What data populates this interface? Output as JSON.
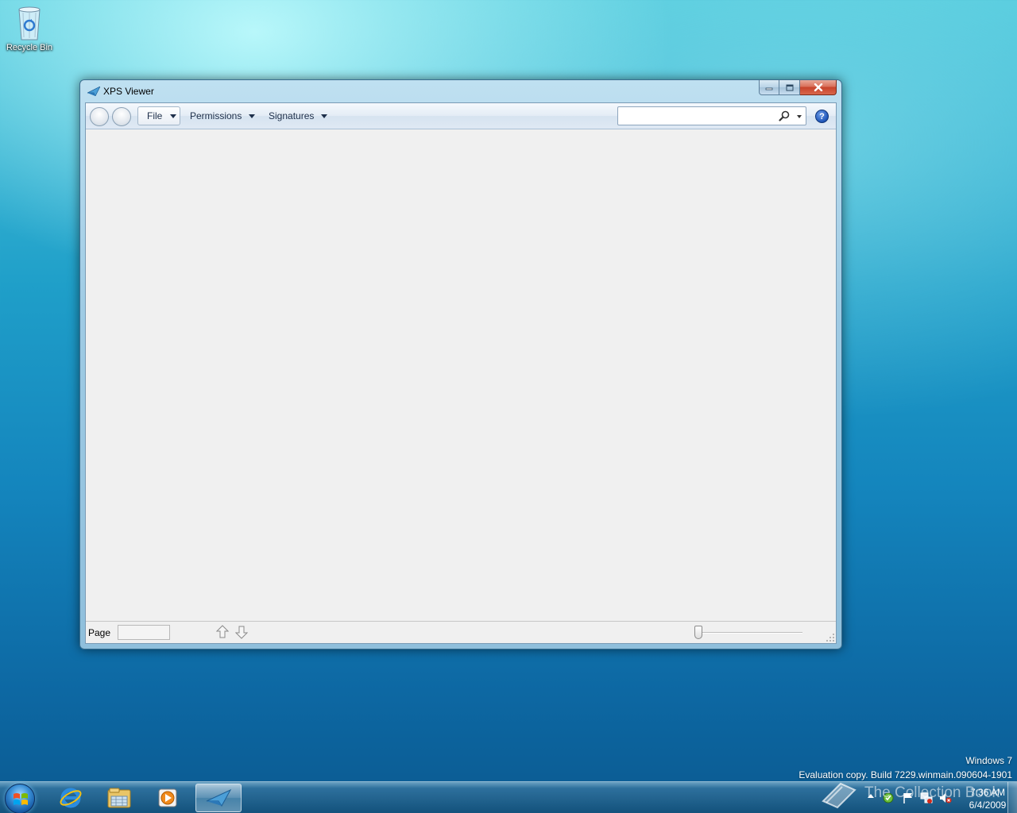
{
  "desktop": {
    "icons": [
      {
        "label": "Recycle Bin",
        "icon": "recycle-bin-icon"
      }
    ],
    "watermark": {
      "line1": "Windows 7",
      "line2": "Evaluation copy. Build 7229.winmain.090604-1901"
    },
    "overlay_logo_text": "The Collection Book"
  },
  "window": {
    "title": "XPS Viewer",
    "app_icon": "xps-viewer-icon",
    "controls": {
      "minimize": "minimize-icon",
      "maximize": "maximize-icon",
      "close": "close-icon"
    },
    "toolbar": {
      "back": "back-arrow-icon",
      "forward": "forward-arrow-icon",
      "menus": [
        {
          "label": "File"
        },
        {
          "label": "Permissions"
        },
        {
          "label": "Signatures"
        }
      ],
      "search": {
        "value": "",
        "placeholder": "",
        "icon": "search-icon"
      },
      "help": "?"
    },
    "statusbar": {
      "page_label": "Page",
      "page_value": "",
      "prev_page": "up-arrow-icon",
      "next_page": "down-arrow-icon",
      "zoom_level": 0
    }
  },
  "taskbar": {
    "start": "windows-start-icon",
    "pinned": [
      {
        "name": "Internet Explorer",
        "icon": "internet-explorer-icon"
      },
      {
        "name": "Windows Explorer",
        "icon": "folder-icon"
      },
      {
        "name": "Windows Media Player",
        "icon": "media-player-icon"
      },
      {
        "name": "XPS Viewer",
        "icon": "xps-viewer-icon",
        "active": true
      }
    ],
    "tray": {
      "icons": [
        "action-center-icon",
        "flag-icon",
        "network-icon",
        "volume-muted-icon"
      ],
      "time": "7:36 AM",
      "date": "6/4/2009"
    }
  },
  "colors": {
    "accent": "#1e55b8",
    "close_button": "#c7432b",
    "desktop_top": "#4fc9dc",
    "desktop_bottom": "#0b5a91"
  }
}
